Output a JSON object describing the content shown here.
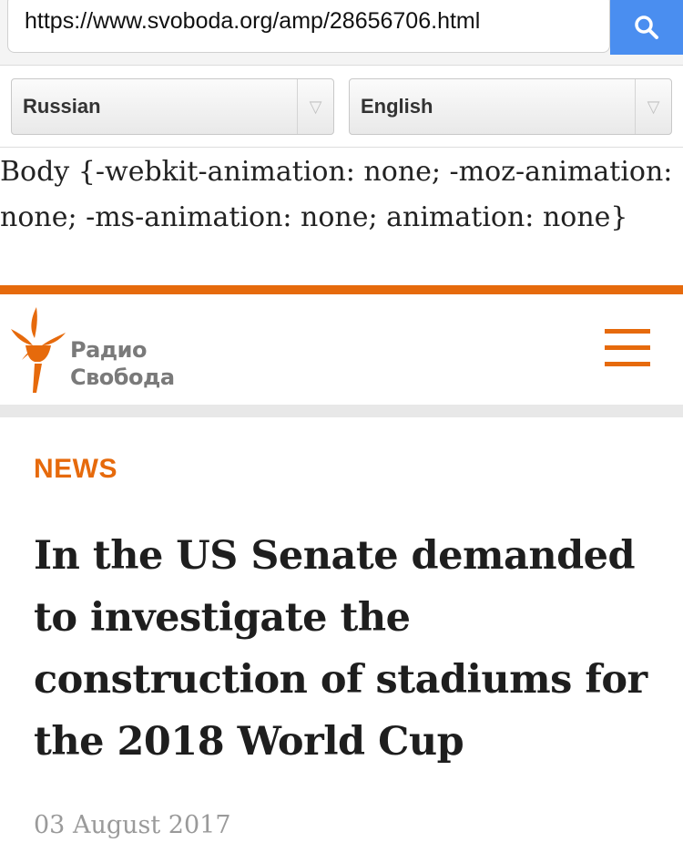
{
  "url_bar": {
    "url": "https://www.svoboda.org/amp/28656706.html",
    "search_icon": "search-icon",
    "accent_color": "#4a8ef0"
  },
  "translator": {
    "source_language": "Russian",
    "target_language": "English",
    "dropdown_icon": "chevron-down-icon"
  },
  "raw_css_text": "Body {-webkit-animation: none; -moz-animation: none; -ms-animation: none; animation: none}",
  "site": {
    "logo_line1": "Радио",
    "logo_line2": "Свобода",
    "logo_icon": "torch-icon",
    "menu_icon": "hamburger-menu-icon",
    "brand_color": "#e66a0c"
  },
  "article": {
    "section": "NEWS",
    "headline": "In the US Senate demanded to investigate the construction of stadiums for the 2018 World Cup",
    "date": "03 August 2017"
  }
}
